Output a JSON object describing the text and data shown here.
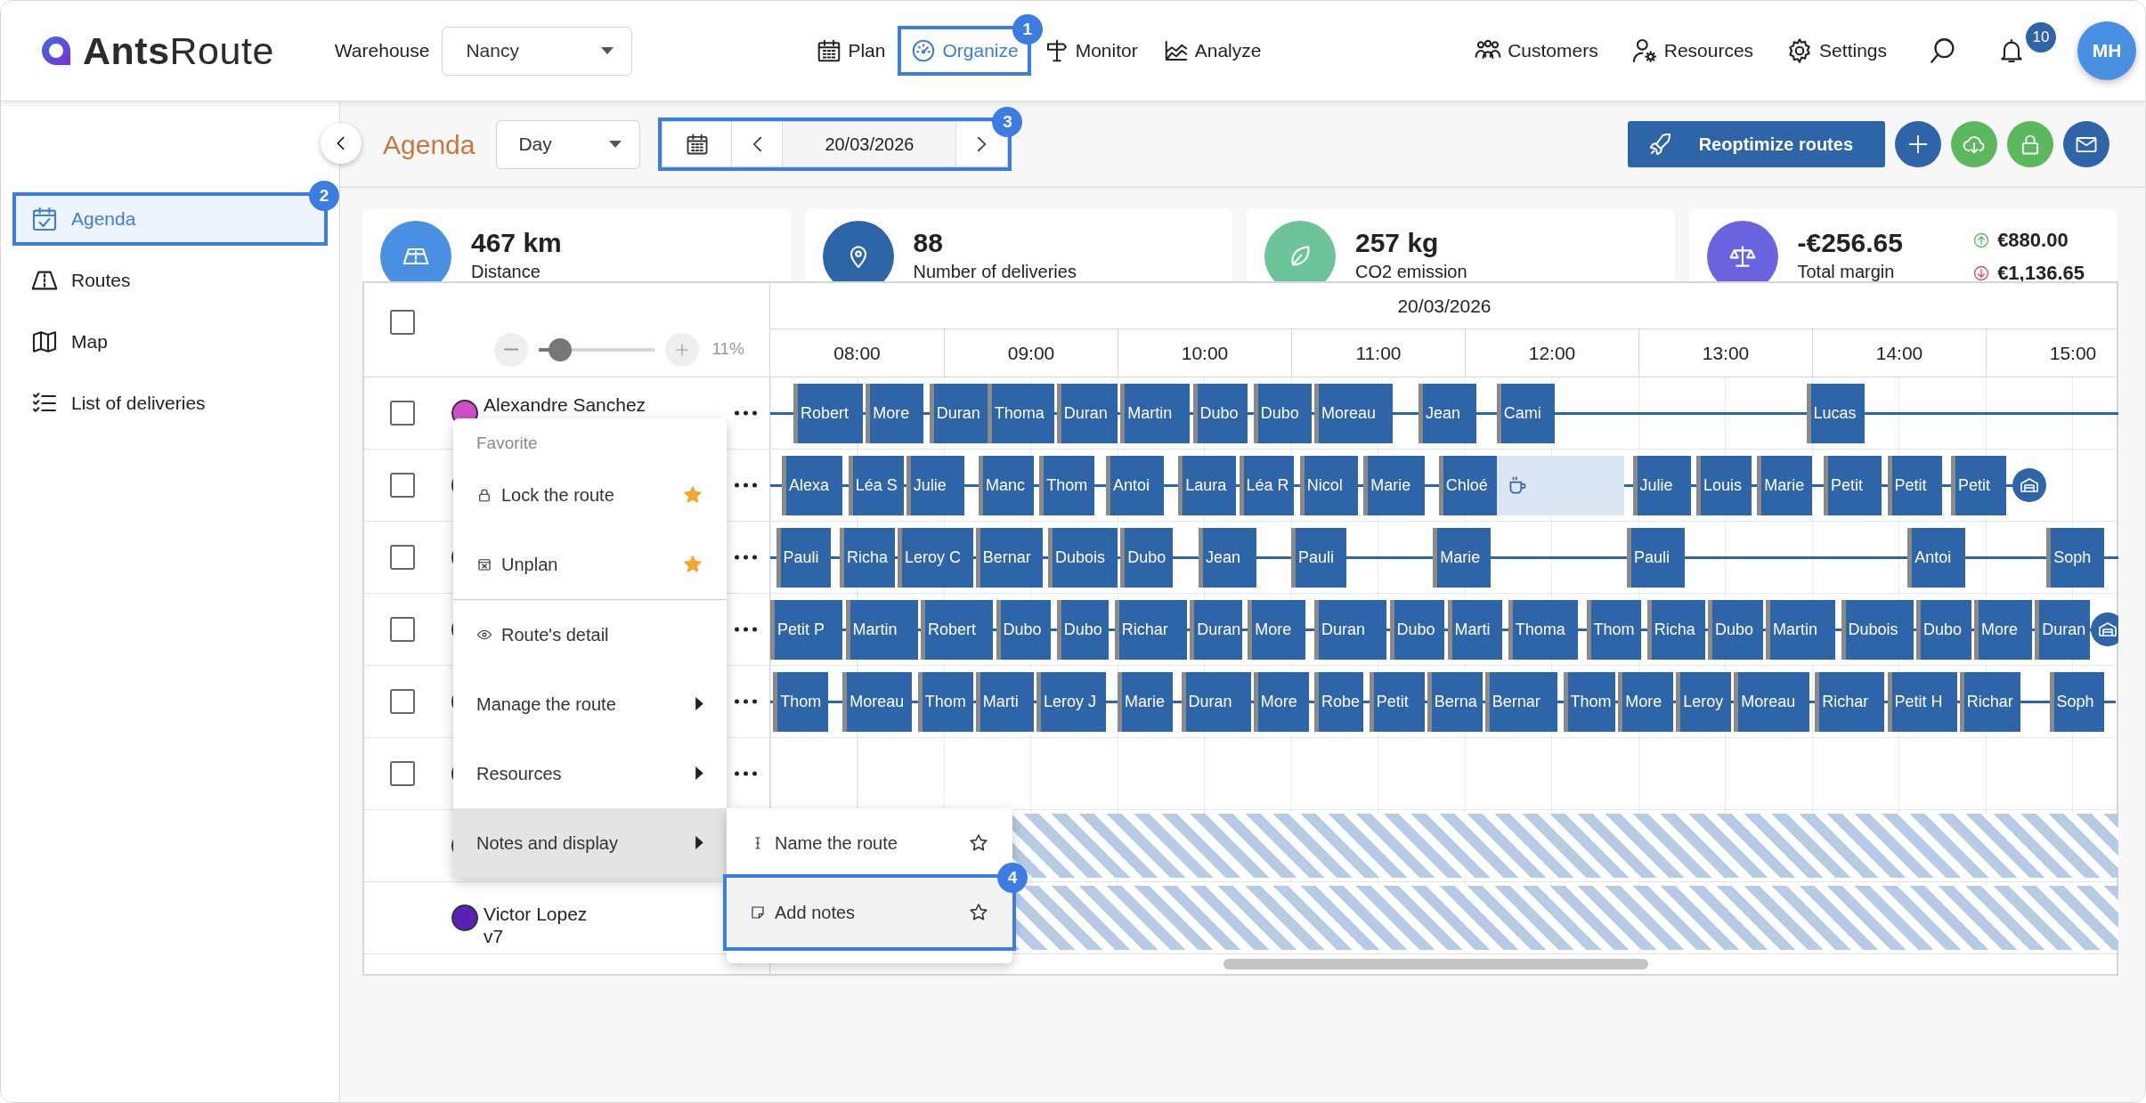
{
  "app": {
    "logo": "**Ants**Route"
  },
  "warehouse": {
    "label": "Warehouse",
    "value": "Nancy"
  },
  "nav": [
    {
      "label": "Plan",
      "selected": false
    },
    {
      "label": "Organize",
      "selected": true,
      "callout": "1"
    },
    {
      "label": "Monitor",
      "selected": false
    },
    {
      "label": "Analyze",
      "selected": false
    }
  ],
  "nav_right": [
    {
      "label": "Customers"
    },
    {
      "label": "Resources"
    },
    {
      "label": "Settings"
    }
  ],
  "notifications": {
    "count": "10"
  },
  "avatar": {
    "initials": "MH"
  },
  "sidebar": [
    {
      "label": "Agenda",
      "selected": true,
      "callout": "2"
    },
    {
      "label": "Routes",
      "selected": false
    },
    {
      "label": "Map",
      "selected": false
    },
    {
      "label": "List of deliveries",
      "selected": false
    }
  ],
  "toolbar": {
    "title": "Agenda",
    "view": "Day",
    "date": "20/03/2026",
    "date_callout": "3",
    "primary_button": "Reoptimize routes",
    "round_buttons": [
      {
        "color": "#2e64a8"
      },
      {
        "color": "#5cb85c"
      },
      {
        "color": "#5cb85c"
      },
      {
        "color": "#2e64a8"
      }
    ]
  },
  "stats": [
    {
      "value": "467 km",
      "label": "Distance",
      "color": "#4a90e2"
    },
    {
      "value": "88",
      "label": "Number of deliveries",
      "color": "#2e64a8"
    },
    {
      "value": "257 kg",
      "label": "CO2 emission",
      "color": "#6cc49a"
    },
    {
      "value": "-€256.65",
      "label": "Total margin",
      "color": "#6c63e0",
      "up": "€880.00",
      "down": "€1,136.65"
    }
  ],
  "gantt": {
    "select_all": {
      "checked": false
    },
    "zoom": {
      "level": 0.18,
      "reading": "11%"
    },
    "date": "20/03/2026",
    "hours": [
      "08:00",
      "09:00",
      "10:00",
      "11:00",
      "12:00",
      "13:00",
      "14:00",
      "15:00"
    ],
    "rows": [
      {
        "name": "Alexandre Sanchez",
        "color": "#d04fc9",
        "checkbox": {
          "checked": false
        },
        "stops": [
          {
            "kind": "stop",
            "label": "Robert"
          },
          {
            "kind": "stop",
            "label": "More"
          },
          {
            "kind": "stop",
            "label": "Duran"
          },
          {
            "kind": "stop",
            "label": "Thoma"
          },
          {
            "kind": "stop",
            "label": "Duran"
          },
          {
            "kind": "stop",
            "label": "Martin"
          },
          {
            "kind": "stop",
            "label": "Dubo"
          },
          {
            "kind": "stop",
            "label": "Dubo"
          },
          {
            "kind": "stop",
            "label": "Moreau"
          },
          {
            "kind": "stop",
            "label": "Jean"
          },
          {
            "kind": "stop",
            "label": "Cami"
          },
          {
            "kind": "stop",
            "label": "Lucas"
          }
        ]
      },
      {
        "checkbox": {
          "checked": false
        },
        "stops": [
          {
            "kind": "stop",
            "label": "Alexa"
          },
          {
            "kind": "stop",
            "label": "Léa S"
          },
          {
            "kind": "stop",
            "label": "Julie"
          },
          {
            "kind": "stop",
            "label": "Manc"
          },
          {
            "kind": "stop",
            "label": "Thom"
          },
          {
            "kind": "stop",
            "label": "Antoi"
          },
          {
            "kind": "stop",
            "label": "Laura"
          },
          {
            "kind": "stop",
            "label": "Léa R"
          },
          {
            "kind": "stop",
            "label": "Nicol"
          },
          {
            "kind": "stop",
            "label": "Marie"
          },
          {
            "kind": "stop",
            "label": "Chloé"
          },
          {
            "kind": "break"
          },
          {
            "kind": "stop",
            "label": "Julie"
          },
          {
            "kind": "stop",
            "label": "Louis"
          },
          {
            "kind": "stop",
            "label": "Marie"
          },
          {
            "kind": "stop",
            "label": "Petit"
          },
          {
            "kind": "stop",
            "label": "Petit"
          },
          {
            "kind": "stop",
            "label": "Petit"
          },
          {
            "kind": "depot"
          }
        ]
      },
      {
        "checkbox": {
          "checked": false
        },
        "stops": [
          {
            "kind": "stop",
            "label": "Pauli"
          },
          {
            "kind": "stop",
            "label": "Richa"
          },
          {
            "kind": "stop",
            "label": "Leroy C"
          },
          {
            "kind": "stop",
            "label": "Bernar"
          },
          {
            "kind": "stop",
            "label": "Dubois"
          },
          {
            "kind": "stop",
            "label": "Dubo"
          },
          {
            "kind": "stop",
            "label": "Jean"
          },
          {
            "kind": "stop",
            "label": "Pauli"
          },
          {
            "kind": "stop",
            "label": "Marie"
          },
          {
            "kind": "stop",
            "label": "Pauli"
          },
          {
            "kind": "stop",
            "label": "Antoi"
          },
          {
            "kind": "stop",
            "label": "Soph"
          }
        ]
      },
      {
        "checkbox": {
          "checked": false
        },
        "stops": [
          {
            "kind": "stop",
            "label": "Petit P"
          },
          {
            "kind": "stop",
            "label": "Martin"
          },
          {
            "kind": "stop",
            "label": "Robert"
          },
          {
            "kind": "stop",
            "label": "Dubo"
          },
          {
            "kind": "stop",
            "label": "Dubo"
          },
          {
            "kind": "stop",
            "label": "Richar"
          },
          {
            "kind": "stop",
            "label": "Duran"
          },
          {
            "kind": "stop",
            "label": "More"
          },
          {
            "kind": "stop",
            "label": "Duran"
          },
          {
            "kind": "stop",
            "label": "Dubo"
          },
          {
            "kind": "stop",
            "label": "Marti"
          },
          {
            "kind": "stop",
            "label": "Thoma"
          },
          {
            "kind": "stop",
            "label": "Thom"
          },
          {
            "kind": "stop",
            "label": "Richa"
          },
          {
            "kind": "stop",
            "label": "Dubo"
          },
          {
            "kind": "stop",
            "label": "Martin"
          },
          {
            "kind": "stop",
            "label": "Dubois"
          },
          {
            "kind": "stop",
            "label": "Dubo"
          },
          {
            "kind": "stop",
            "label": "More"
          },
          {
            "kind": "stop",
            "label": "Duran"
          },
          {
            "kind": "depot"
          }
        ]
      },
      {
        "checkbox": {
          "checked": false
        },
        "stops": [
          {
            "kind": "stop",
            "label": "Thom"
          },
          {
            "kind": "stop",
            "label": "Moreau"
          },
          {
            "kind": "stop",
            "label": "Thom"
          },
          {
            "kind": "stop",
            "label": "Marti"
          },
          {
            "kind": "stop",
            "label": "Leroy J"
          },
          {
            "kind": "stop",
            "label": "Marie"
          },
          {
            "kind": "stop",
            "label": "Duran"
          },
          {
            "kind": "stop",
            "label": "More"
          },
          {
            "kind": "stop",
            "label": "Robe"
          },
          {
            "kind": "stop",
            "label": "Petit"
          },
          {
            "kind": "stop",
            "label": "Berna"
          },
          {
            "kind": "stop",
            "label": "Bernar"
          },
          {
            "kind": "stop",
            "label": "Thom"
          },
          {
            "kind": "stop",
            "label": "More"
          },
          {
            "kind": "stop",
            "label": "Leroy"
          },
          {
            "kind": "stop",
            "label": "Moreau"
          },
          {
            "kind": "stop",
            "label": "Richar"
          },
          {
            "kind": "stop",
            "label": "Petit H"
          },
          {
            "kind": "stop",
            "label": "Richar"
          },
          {
            "kind": "stop",
            "label": "Soph"
          }
        ]
      },
      {
        "checkbox": {
          "checked": false
        },
        "stops": []
      },
      {
        "striped": true,
        "stops": []
      },
      {
        "name": "Victor Lopez",
        "subtitle": "v7",
        "color": "#5b21b6",
        "striped": true,
        "stops": []
      }
    ]
  },
  "menu": {
    "header": "Favorite",
    "items": [
      {
        "kind": "favorite",
        "label": "Lock the route",
        "starred": true,
        "highlighted": false
      },
      {
        "kind": "favorite",
        "label": "Unplan",
        "starred": true,
        "highlighted": false
      },
      {
        "kind": "action",
        "label": "Route's detail",
        "highlighted": false
      },
      {
        "kind": "submenu",
        "label": "Manage the route",
        "highlighted": false
      },
      {
        "kind": "submenu",
        "label": "Resources",
        "highlighted": false
      },
      {
        "kind": "submenu",
        "label": "Notes and display",
        "highlighted": true
      }
    ]
  },
  "submenu": {
    "items": [
      {
        "label": "Name the route",
        "starred": false,
        "highlighted": false
      },
      {
        "label": "Add notes",
        "starred": false,
        "highlighted": true,
        "callout": "4"
      }
    ]
  }
}
